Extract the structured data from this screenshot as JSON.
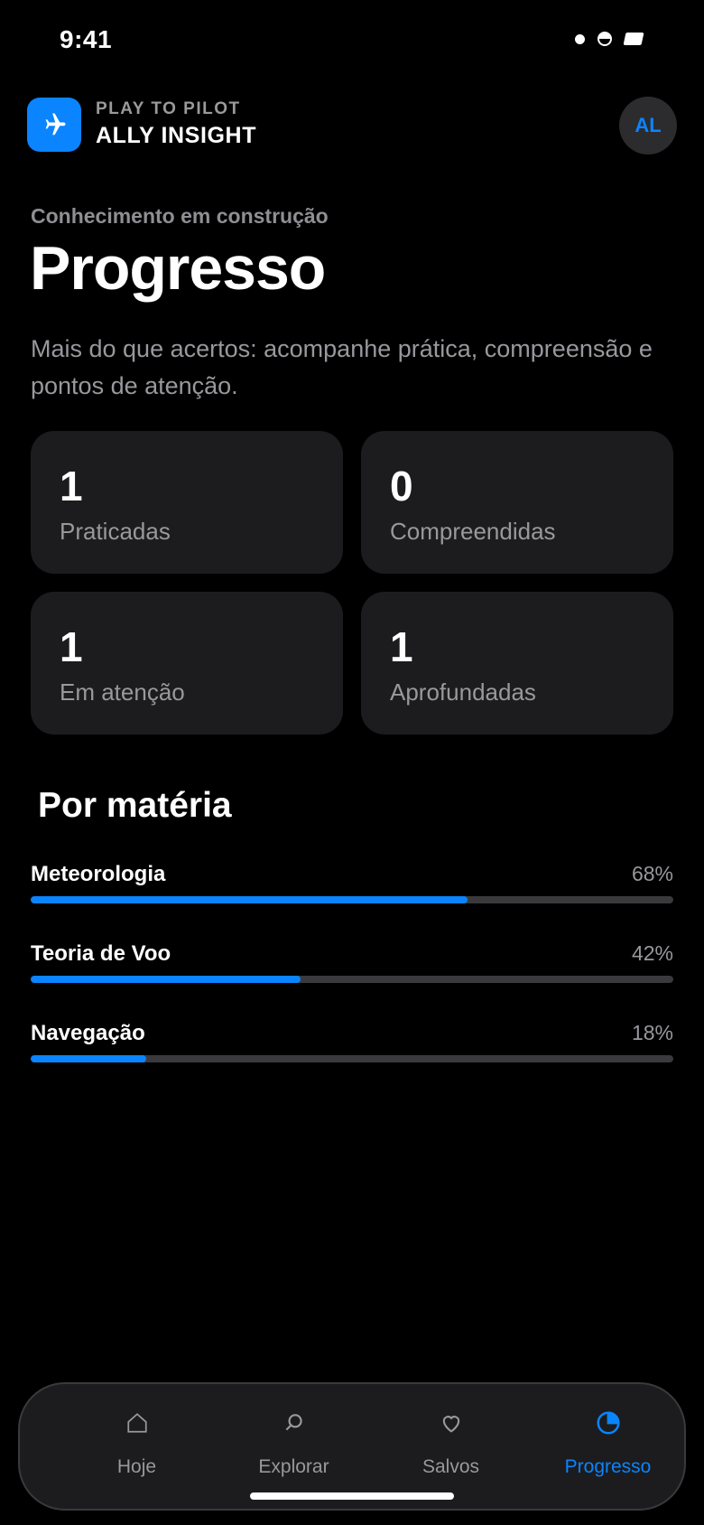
{
  "status_bar": {
    "time": "9:41"
  },
  "header": {
    "brand_sub": "PLAY TO PILOT",
    "brand_title": "ALLY INSIGHT",
    "avatar_initials": "AL",
    "accent": "#0a84ff"
  },
  "page": {
    "kicker": "Conhecimento em construção",
    "title": "Progresso",
    "subtitle": "Mais do que acertos: acompanhe prática, compreensão e pontos de atenção."
  },
  "stats": [
    {
      "value": "1",
      "label": "Praticadas"
    },
    {
      "value": "0",
      "label": "Compreendidas"
    },
    {
      "value": "1",
      "label": "Em atenção"
    },
    {
      "value": "1",
      "label": "Aprofundadas"
    }
  ],
  "subjects_section": {
    "title": "Por matéria",
    "items": [
      {
        "name": "Meteorologia",
        "percent_label": "68%",
        "percent": 68
      },
      {
        "name": "Teoria de Voo",
        "percent_label": "42%",
        "percent": 42
      },
      {
        "name": "Navegação",
        "percent_label": "18%",
        "percent": 18
      }
    ]
  },
  "tabbar": {
    "tabs": [
      {
        "label": "Hoje",
        "icon": "home-icon",
        "active": false
      },
      {
        "label": "Explorar",
        "icon": "search-icon",
        "active": false
      },
      {
        "label": "Salvos",
        "icon": "heart-icon",
        "active": false
      },
      {
        "label": "Progresso",
        "icon": "pie-chart-icon",
        "active": true
      }
    ]
  }
}
